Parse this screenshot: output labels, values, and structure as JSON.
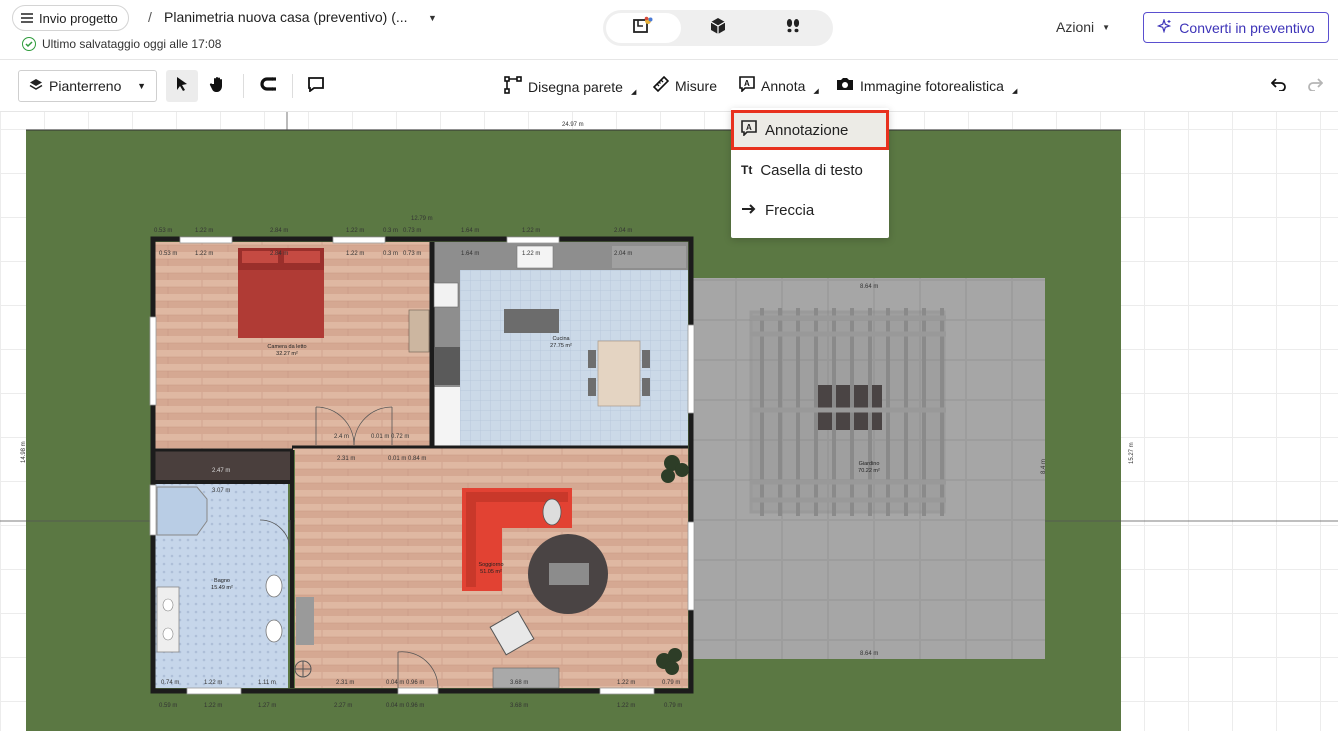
{
  "header": {
    "submit_label": "Invio progetto",
    "breadcrumb_separator": "/",
    "project_title": "Planimetria nuova casa (preventivo) (...",
    "save_status": "Ultimo salvataggio oggi alle 17:08",
    "actions_label": "Azioni",
    "convert_label": "Converti in preventivo",
    "view_modes": [
      "2D/3D",
      "3D",
      "Walkthrough"
    ]
  },
  "toolbar": {
    "floor": "Pianterreno",
    "draw_wall": "Disegna parete",
    "measures": "Misure",
    "annotate": "Annota",
    "photoreal": "Immagine fotorealistica"
  },
  "dropdown": {
    "items": [
      "Annotazione",
      "Casella di testo",
      "Freccia"
    ]
  },
  "plan": {
    "dims": {
      "top_total": "24.97 m",
      "left_total": "14.98 m",
      "right_total": "15.27 m",
      "top_wall": "12.79 m",
      "patio_top": "8.64 m",
      "patio_bottom": "8.64 m",
      "patio_side": "8.4 m",
      "d_0_53": "0.53 m",
      "d_1_22a": "1.22 m",
      "d_2_84": "2.84 m",
      "d_1_22b": "1.22 m",
      "d_0_3": "0.3 m",
      "d_0_73": "0.73 m",
      "d_1_64": "1.64 m",
      "d_1_22c": "1.22 m",
      "d_2_04": "2.04 m",
      "d_2_47": "2.47 m",
      "d_2_31": "2.31 m",
      "d_3_07": "3.07 m",
      "d_1_22d": "1.22 m",
      "d_1_11": "1.11 m",
      "d_0_74": "0.74 m",
      "d_0_04": "0.04 m 0.96 m",
      "d_3_68": "3.68 m",
      "d_1_22e": "1.22 m",
      "d_0_79": "0.79 m",
      "d_2_31b": "2.31 m",
      "d_2_4": "2.4 m",
      "d_0_01": "0.01 m 0.72 m",
      "d_2_31c": "2.31 m",
      "d_0_01b": "0.01 m 0.84 m"
    },
    "rooms": {
      "bedroom": "Camera da letto",
      "bedroom_area": "32.27 m²",
      "kitchen": "Cucina",
      "kitchen_area": "27.75 m²",
      "garden": "Giardino",
      "garden_area": "70.22 m²",
      "bathroom": "Bagno",
      "bathroom_area": "15.49 m²",
      "living": "Soggiorno",
      "living_area": "51.05 m²"
    }
  },
  "colors": {
    "accent": "#3d33b8",
    "highlight": "#e8311e",
    "grass": "#5d7a45",
    "wood": "#dcb49e",
    "tile_blue": "#c8d8ec",
    "patio": "#9a9a9a",
    "wall": "#1e1e1e"
  }
}
